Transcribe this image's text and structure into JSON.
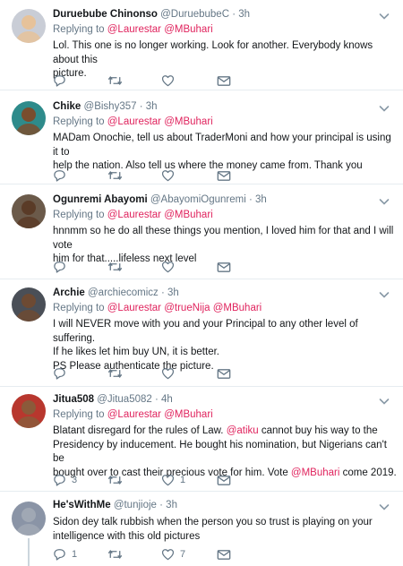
{
  "tweets": [
    {
      "name": "Duruebube Chinonso",
      "handle": "@DuruebubeC",
      "time": "3h",
      "replying_prefix": "Replying to",
      "replying_to": [
        "@Laurestar",
        "@MBuhari"
      ],
      "body": [
        "Lol. This one is no longer working. Look for another. Everybody knows about this",
        "picture."
      ],
      "counts": {
        "reply": "",
        "retweet": "",
        "like": ""
      },
      "avatar_color": "#c9cdd6"
    },
    {
      "name": "Chike",
      "handle": "@Bishy357",
      "time": "3h",
      "replying_prefix": "Replying to",
      "replying_to": [
        "@Laurestar",
        "@MBuhari"
      ],
      "body": [
        "MADam Onochie, tell us about TraderMoni and how your principal is using it to",
        "help the nation. Also tell us where the money came from. Thank you"
      ],
      "counts": {
        "reply": "",
        "retweet": "",
        "like": ""
      },
      "avatar_color": "#2e8b8b"
    },
    {
      "name": "Ogunremi Abayomi",
      "handle": "@AbayomiOgunremi",
      "time": "3h",
      "replying_prefix": "Replying to",
      "replying_to": [
        "@Laurestar",
        "@MBuhari"
      ],
      "body": [
        "hnnmm so he do all these things you mention, I loved him for that and I will vote",
        "him for that.....lifeless next level"
      ],
      "counts": {
        "reply": "",
        "retweet": "",
        "like": ""
      },
      "avatar_color": "#6b5a4a"
    },
    {
      "name": "Archie",
      "handle": "@archiecomicz",
      "time": "3h",
      "replying_prefix": "Replying to",
      "replying_to": [
        "@Laurestar",
        "@trueNija",
        "@MBuhari"
      ],
      "body": [
        "I will NEVER move with you and your Principal to any other level of suffering.",
        "If he likes let him buy UN, it is better.",
        "PS Please authenticate the picture."
      ],
      "counts": {
        "reply": "",
        "retweet": "",
        "like": ""
      },
      "avatar_color": "#4a4f57"
    },
    {
      "name": "Jitua508",
      "handle": "@Jitua5082",
      "time": "4h",
      "replying_prefix": "Replying to",
      "replying_to": [
        "@Laurestar",
        "@MBuhari"
      ],
      "body_rich": [
        [
          {
            "t": "Blatant disregard for the rules of Law. "
          },
          {
            "t": "@atiku",
            "m": true
          },
          {
            "t": " cannot buy his way to the"
          }
        ],
        [
          {
            "t": "Presidency by inducement. He bought his nomination, but Nigerians can't be"
          }
        ],
        [
          {
            "t": "bought over to cast their precious vote for him. Vote "
          },
          {
            "t": "@MBuhari",
            "m": true
          },
          {
            "t": "  come 2019."
          }
        ]
      ],
      "counts": {
        "reply": "3",
        "retweet": "",
        "like": "1"
      },
      "avatar_color": "#b8372e"
    },
    {
      "name": "He'sWithMe",
      "handle": "@tunjioje",
      "time": "3h",
      "replying_prefix": "",
      "replying_to": [],
      "body": [
        "Sidon dey talk rubbish when the person you so trust is playing on your",
        "intelligence with this old pictures"
      ],
      "counts": {
        "reply": "1",
        "retweet": "",
        "like": "7"
      },
      "avatar_color": "#8a94a6"
    }
  ],
  "icons": {
    "reply": "reply-icon",
    "retweet": "retweet-icon",
    "like": "heart-icon",
    "dm": "mail-icon",
    "caret": "chevron-down-icon"
  },
  "colors": {
    "mention": "#e0245e",
    "muted": "#657786",
    "divider": "#e6ecf0"
  }
}
